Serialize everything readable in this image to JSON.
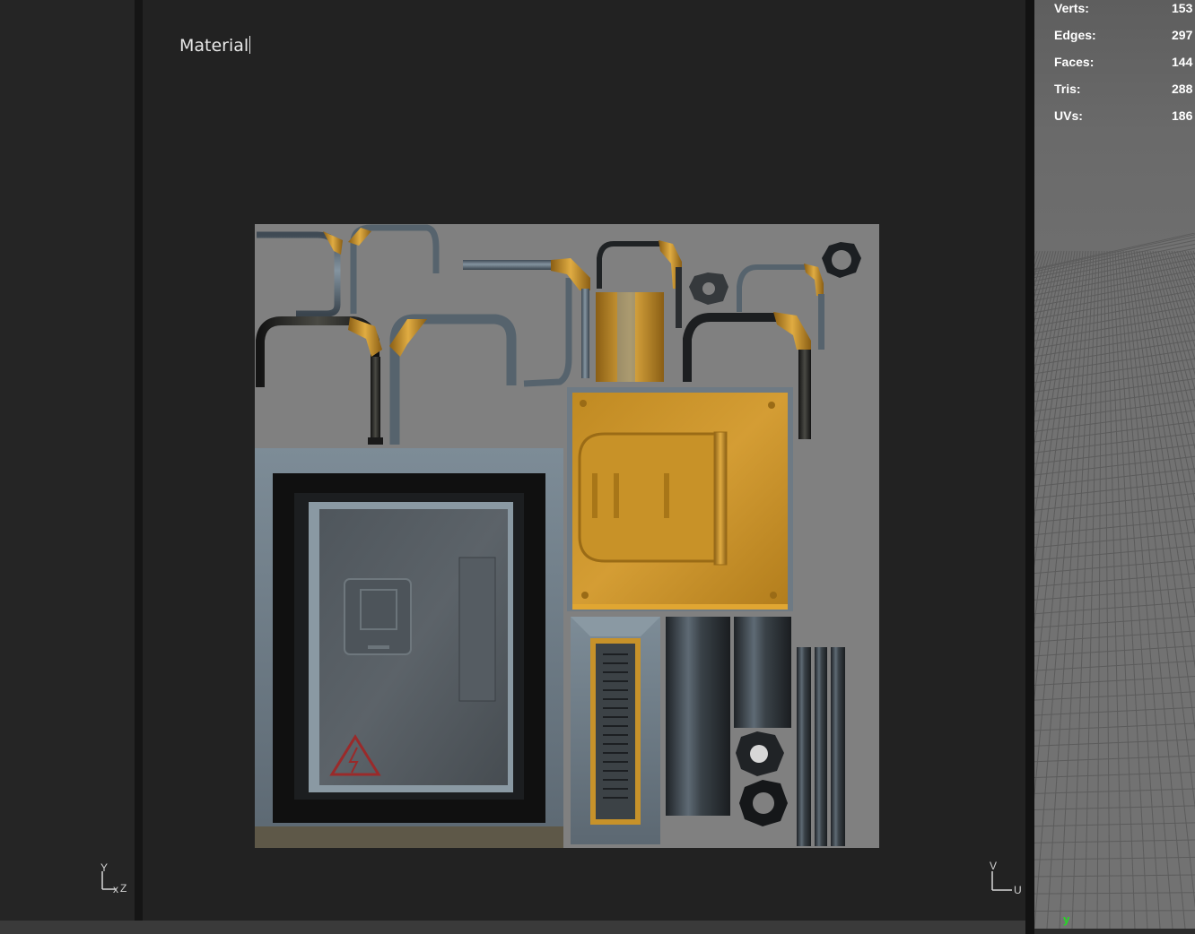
{
  "viewport": {
    "material_label": "Material"
  },
  "stats": [
    {
      "label": "Verts:",
      "value": "153"
    },
    {
      "label": "Edges:",
      "value": "297"
    },
    {
      "label": "Faces:",
      "value": "144"
    },
    {
      "label": "Tris:",
      "value": "288"
    },
    {
      "label": "UVs:",
      "value": "186"
    }
  ],
  "axis_gizmo_left": {
    "y": "Y",
    "x": "x",
    "z": "Z"
  },
  "axis_gizmo_uv": {
    "v": "V",
    "u": "U"
  },
  "axis_gizmo_3d": {
    "y": "y"
  },
  "colors": {
    "background": "#222222",
    "uv_canvas": "#808080",
    "metal_blue": "#6b7a86",
    "brass": "#c7922a",
    "dark_pipe": "#2e2e2a",
    "warning_red": "#9a2a2a"
  }
}
